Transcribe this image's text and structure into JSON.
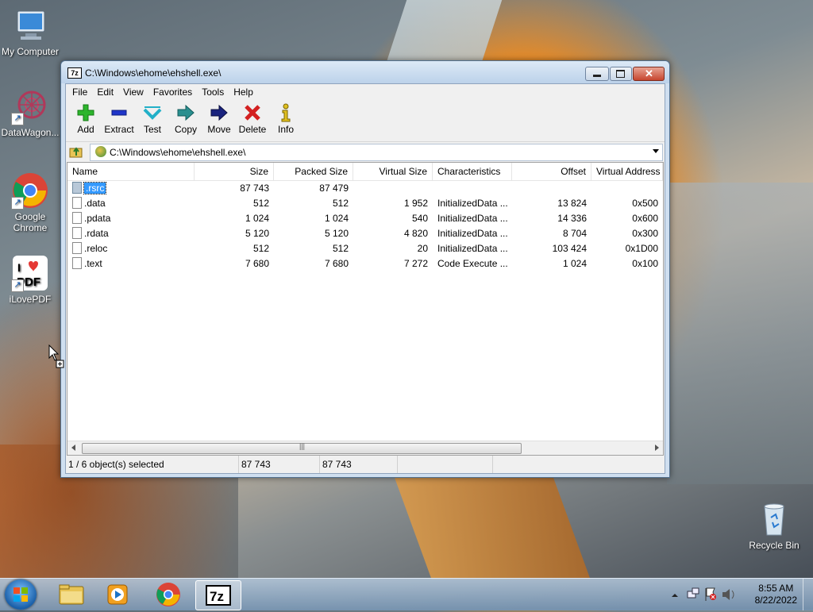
{
  "desktop": {
    "icons": [
      {
        "label": "My Computer",
        "icon": "computer-icon"
      },
      {
        "label": "DataWagon...",
        "icon": "datawagon-icon"
      },
      {
        "label": "Google Chrome",
        "icon": "chrome-icon"
      },
      {
        "label": "iLovePDF",
        "icon": "ilovepdf-icon"
      },
      {
        "label": "Recycle Bin",
        "icon": "recycle-bin-icon"
      }
    ]
  },
  "window": {
    "title": "C:\\Windows\\ehome\\ehshell.exe\\",
    "app_icon_text": "7z",
    "menu": [
      "File",
      "Edit",
      "View",
      "Favorites",
      "Tools",
      "Help"
    ],
    "toolbar": [
      {
        "label": "Add",
        "icon": "plus-icon",
        "color": "#2db52d"
      },
      {
        "label": "Extract",
        "icon": "minus-icon",
        "color": "#1f35c9"
      },
      {
        "label": "Test",
        "icon": "check-icon",
        "color": "#22b0c8"
      },
      {
        "label": "Copy",
        "icon": "double-arrow-icon",
        "color": "#2a8f8f"
      },
      {
        "label": "Move",
        "icon": "arrow-right-icon",
        "color": "#1a237e"
      },
      {
        "label": "Delete",
        "icon": "x-icon",
        "color": "#d32020"
      },
      {
        "label": "Info",
        "icon": "info-icon",
        "color": "#e0c020"
      }
    ],
    "address": "C:\\Windows\\ehome\\ehshell.exe\\",
    "columns": [
      "Name",
      "Size",
      "Packed Size",
      "Virtual Size",
      "Characteristics",
      "Offset",
      "Virtual Address"
    ],
    "rows": [
      {
        "name": ".rsrc",
        "size": "87 743",
        "packed": "87 479",
        "vsize": "",
        "chars": "",
        "offset": "",
        "vaddr": "",
        "selected": true
      },
      {
        "name": ".data",
        "size": "512",
        "packed": "512",
        "vsize": "1 952",
        "chars": "InitializedData ...",
        "offset": "13 824",
        "vaddr": "0x500",
        "selected": false
      },
      {
        "name": ".pdata",
        "size": "1 024",
        "packed": "1 024",
        "vsize": "540",
        "chars": "InitializedData ...",
        "offset": "14 336",
        "vaddr": "0x600",
        "selected": false
      },
      {
        "name": ".rdata",
        "size": "5 120",
        "packed": "5 120",
        "vsize": "4 820",
        "chars": "InitializedData ...",
        "offset": "8 704",
        "vaddr": "0x300",
        "selected": false
      },
      {
        "name": ".reloc",
        "size": "512",
        "packed": "512",
        "vsize": "20",
        "chars": "InitializedData ...",
        "offset": "103 424",
        "vaddr": "0x1D00",
        "selected": false
      },
      {
        "name": ".text",
        "size": "7 680",
        "packed": "7 680",
        "vsize": "7 272",
        "chars": "Code Execute ...",
        "offset": "1 024",
        "vaddr": "0x100",
        "selected": false
      }
    ],
    "status": {
      "selection": "1 / 6 object(s) selected",
      "size": "87 743",
      "packed": "87 743"
    }
  },
  "taskbar": {
    "items": [
      {
        "icon": "explorer-icon"
      },
      {
        "icon": "media-player-icon"
      },
      {
        "icon": "chrome-icon"
      },
      {
        "icon": "7zip-icon",
        "text": "7z",
        "active": true
      }
    ],
    "time": "8:55 AM",
    "date": "8/22/2022"
  }
}
